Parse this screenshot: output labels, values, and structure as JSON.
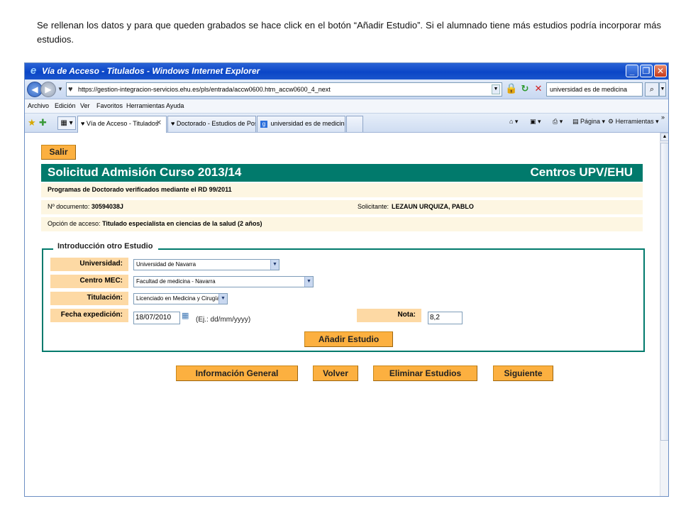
{
  "caption": "Se rellenan los datos y para que queden grabados se hace click en el botón “Añadir Estudio”. Si el alumnado tiene más estudios podría incorporar más estudios.",
  "window": {
    "title": "Vía de Acceso - Titulados - Windows Internet Explorer",
    "min": "_",
    "max": "❐",
    "close": "✕"
  },
  "address": {
    "url": "https://gestion-integracion-servicios.ehu.es/pls/entrada/accw0600.htm_accw0600_4_next",
    "search_value": "universidad es de medicina"
  },
  "menu": [
    "Archivo",
    "Edición",
    "Ver",
    "Favoritos",
    "Herramientas",
    "Ayuda"
  ],
  "tabs": [
    {
      "label": "Vía de Acceso - Titulados"
    },
    {
      "label": "Doctorado - Estudios de Post..."
    },
    {
      "label": "universidad es de medicina - ..."
    }
  ],
  "toolbar_right": {
    "page": "Página",
    "tools": "Herramientas"
  },
  "page": {
    "exit_label": "Salir",
    "header_left": "Solicitud Admisión Curso 2013/14",
    "header_right": "Centros UPV/EHU",
    "program": "Programas de Doctorado verificados mediante el RD 99/2011",
    "doc_label": "Nº documento:",
    "doc_value": "30594038J",
    "applicant_label": "Solicitante:",
    "applicant_value": "LEZAUN URQUIZA, PABLO",
    "access_label": "Opción de acceso:",
    "access_value": "Titulado especialista en ciencias de la salud (2 años)"
  },
  "form": {
    "legend": "Introducción otro Estudio",
    "university_label": "Universidad:",
    "university_value": "Universidad de Navarra",
    "center_label": "Centro MEC:",
    "center_value": "Facultad de medicina - Navarra",
    "degree_label": "Titulación:",
    "degree_value": "Licenciado en Medicina y Cirugía",
    "date_label": "Fecha expedición:",
    "date_value": "18/07/2010",
    "date_hint": "(Ej.: dd/mm/yyyy)",
    "grade_label": "Nota:",
    "grade_value": "8,2",
    "add_button": "Añadir Estudio"
  },
  "bottom_buttons": [
    "Información General",
    "Volver",
    "Eliminar Estudios",
    "Siguiente"
  ]
}
